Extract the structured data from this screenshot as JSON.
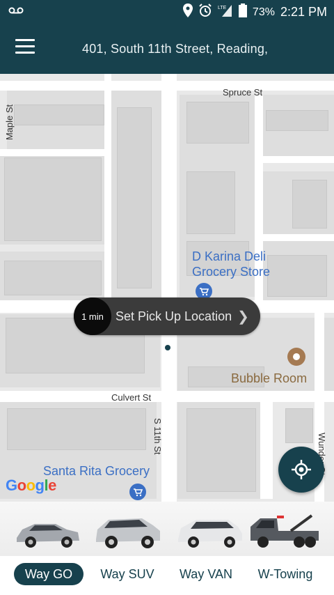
{
  "status_bar": {
    "battery": "73%",
    "time": "2:21 PM",
    "network": "LTE",
    "icons": [
      "voicemail-icon",
      "location-icon",
      "alarm-icon",
      "signal-icon",
      "battery-icon"
    ]
  },
  "app_bar": {
    "address": "401, South 11th Street, Reading,",
    "menu_icon": "hamburger-menu-icon"
  },
  "map": {
    "streets": {
      "spruce": "Spruce St",
      "maple": "Maple St",
      "culvert": "Culvert St",
      "s11th": "S 11th St",
      "wunder": "Wunder St"
    },
    "pois": {
      "deli_line1": "D Karina Deli",
      "deli_line2": "Grocery Store",
      "bubble_room": "Bubble Room",
      "santa_rita": "Santa Rita Grocery"
    },
    "pickup": {
      "eta": "1 min",
      "label": "Set Pick Up Location"
    },
    "google_logo": "Google",
    "colors": {
      "poi_blue": "#3b6fc4",
      "poi_brown": "#8a6a3f",
      "accent": "#17414d"
    }
  },
  "vehicles": [
    {
      "name": "sedan-car-image"
    },
    {
      "name": "suv-car-image"
    },
    {
      "name": "minivan-car-image"
    },
    {
      "name": "tow-truck-image"
    }
  ],
  "tabs": [
    {
      "label": "Way GO",
      "active": true
    },
    {
      "label": "Way SUV",
      "active": false
    },
    {
      "label": "Way VAN",
      "active": false
    },
    {
      "label": "W-Towing",
      "active": false
    }
  ]
}
